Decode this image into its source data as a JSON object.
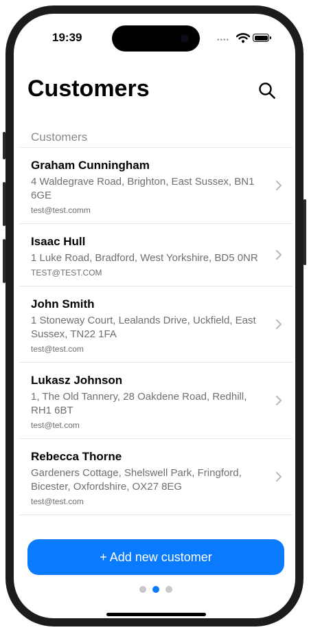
{
  "status": {
    "time": "19:39"
  },
  "header": {
    "title": "Customers"
  },
  "list": {
    "section_title": "Customers",
    "customers": [
      {
        "name": "Graham Cunningham",
        "address": "4 Waldegrave Road, Brighton, East Sussex, BN1 6GE",
        "email": "test@test.comm"
      },
      {
        "name": "Isaac Hull",
        "address": "1 Luke Road, Bradford, West Yorkshire, BD5 0NR",
        "email": "TEST@TEST.COM"
      },
      {
        "name": "John Smith",
        "address": "1 Stoneway Court, Lealands Drive, Uckfield, East Sussex, TN22 1FA",
        "email": "test@test.com"
      },
      {
        "name": "Lukasz Johnson",
        "address": "1, The Old Tannery, 28 Oakdene Road, Redhill, RH1 6BT",
        "email": "test@tet.com"
      },
      {
        "name": "Rebecca Thorne",
        "address": "Gardeners Cottage, Shelswell Park, Fringford, Bicester, Oxfordshire, OX27 8EG",
        "email": "test@test.com"
      }
    ]
  },
  "actions": {
    "add_label": "+ Add new customer"
  },
  "pager": {
    "page_count": 3,
    "current_page": 2
  },
  "colors": {
    "accent": "#0a7aff",
    "secondary_text": "#6e6e73",
    "separator": "#e5e5ea"
  }
}
